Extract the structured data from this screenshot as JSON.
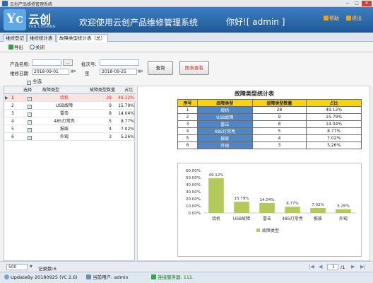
{
  "window": {
    "title": "云创产品维修管理系统",
    "min": "—",
    "max": "□",
    "close": "✕"
  },
  "header": {
    "logo_text": "Yc",
    "brand": "云创",
    "brand_sub": "YUN CHUANG",
    "welcome": "欢迎使用云创产品维修管理系统",
    "greeting": "你好![ admin ]",
    "help_link": "帮助",
    "exit_link": "退出"
  },
  "tabs": [
    {
      "label": "维修登记"
    },
    {
      "label": "维修统计表"
    },
    {
      "label": "故障类型统计表（总）"
    }
  ],
  "toolbar": {
    "export_label": "导出",
    "close_label": "关闭"
  },
  "filters": {
    "product_name_label": "产品名称:",
    "product_name_value": "",
    "browse_label": "...",
    "batch_label": "批次号:",
    "batch_value": "",
    "date_label": "维修日期",
    "date_from": "2018-09-01",
    "to_label": "至",
    "date_to": "2018-09-25",
    "query_label": "查询",
    "chart_label": "图表查看",
    "select_all_label": "全选"
  },
  "grid": {
    "columns": [
      "选择",
      "故障类型",
      "故障类型数量",
      "占比"
    ],
    "rows": [
      {
        "no": "1",
        "type": "烧机",
        "count": "28",
        "pct": "49.12%"
      },
      {
        "no": "2",
        "type": "USB故障",
        "count": "9",
        "pct": "15.79%"
      },
      {
        "no": "3",
        "type": "雷击",
        "count": "8",
        "pct": "14.04%"
      },
      {
        "no": "4",
        "type": "485灯常亮",
        "count": "5",
        "pct": "8.77%"
      },
      {
        "no": "5",
        "type": "报废",
        "count": "4",
        "pct": "7.02%"
      },
      {
        "no": "6",
        "type": "外观",
        "count": "3",
        "pct": "5.26%"
      }
    ]
  },
  "report": {
    "title": "故障类型统计表",
    "columns": [
      "序号",
      "故障类型",
      "故障类型数量",
      "占比"
    ],
    "rows": [
      {
        "no": "1",
        "type": "烧机",
        "count": "28",
        "pct": "49.12%"
      },
      {
        "no": "2",
        "type": "USB故障",
        "count": "9",
        "pct": "15.79%"
      },
      {
        "no": "3",
        "type": "雷击",
        "count": "8",
        "pct": "14.04%"
      },
      {
        "no": "4",
        "type": "485灯常亮",
        "count": "5",
        "pct": "8.77%"
      },
      {
        "no": "5",
        "type": "报废",
        "count": "4",
        "pct": "7.02%"
      },
      {
        "no": "6",
        "type": "外观",
        "count": "3",
        "pct": "5.26%"
      }
    ]
  },
  "chart_data": {
    "type": "bar",
    "categories": [
      "烧机",
      "USB故障",
      "雷击",
      "485灯常亮",
      "报废",
      "外观"
    ],
    "series": [
      {
        "name": "故障类型",
        "values": [
          49.12,
          15.79,
          14.04,
          8.77,
          7.02,
          5.26
        ]
      }
    ],
    "data_labels": [
      "49.12%",
      "15.79%",
      "14.04%",
      "8.77%",
      "7.02%",
      "5.26%"
    ],
    "yticks": [
      "60.00%",
      "50.00%",
      "40.00%",
      "30.00%",
      "20.00%",
      "10.00%",
      "0.00%"
    ],
    "ylim": [
      0,
      60
    ],
    "bar_color": "#b3c95a",
    "legend_position": "bottom"
  },
  "pager": {
    "page_size": "500",
    "record_count": "记录数:6",
    "page_input": "1",
    "page_total": "/1"
  },
  "status": {
    "update": "UpdateBy 20180925 (YC 2.6)",
    "user": "当前用户: admin",
    "server": "连接服务器: 112."
  }
}
